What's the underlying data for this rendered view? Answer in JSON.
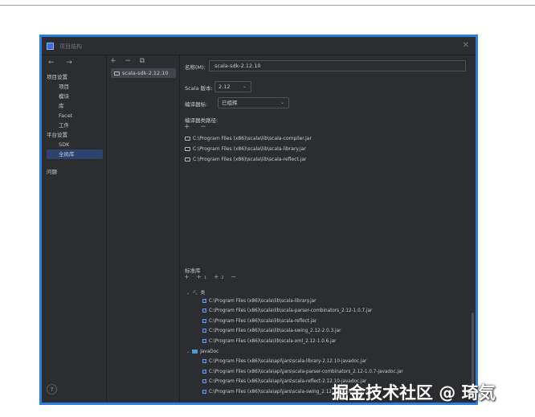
{
  "window": {
    "title": "项目结构",
    "close": "✕"
  },
  "nav": {
    "arrows": "← →",
    "items": [
      {
        "label": "项目设置",
        "type": "head"
      },
      {
        "label": "项目",
        "type": "sub"
      },
      {
        "label": "模块",
        "type": "sub"
      },
      {
        "label": "库",
        "type": "sub"
      },
      {
        "label": "Facet",
        "type": "sub"
      },
      {
        "label": "工件",
        "type": "sub"
      },
      {
        "label": "平台设置",
        "type": "head"
      },
      {
        "label": "SDK",
        "type": "sub"
      },
      {
        "label": "全局库",
        "type": "sub",
        "selected": true
      },
      {
        "label": "问题",
        "type": "head"
      }
    ]
  },
  "middle": {
    "toolbar": "+ − ⧉",
    "sdk": "scala-sdk-2.12.10"
  },
  "form": {
    "name_label": "名称(M):",
    "name_value": "scala-sdk-2.12.10",
    "version_label": "Scala 版本:",
    "version_value": "2.12",
    "compiler_label": "编译器标:",
    "compiler_value": "已组辉",
    "classpath_label": "编译器类路径:",
    "classpath_toolbar": "+ −",
    "classpath": [
      "C:\\Program Files (x86)\\scala\\lib\\scala-compiler.jar",
      "C:\\Program Files (x86)\\scala\\lib\\scala-library.jar",
      "C:\\Program Files (x86)\\scala\\lib\\scala-reflect.jar"
    ]
  },
  "standard": {
    "label": "标准库",
    "toolbar": "+ +₁ +₂ −",
    "classes_label": "类",
    "classes": [
      "C:\\Program Files (x86)\\scala\\lib\\scala-library.jar",
      "C:\\Program Files (x86)\\scala\\lib\\scala-parser-combinators_2.12-1.0.7.jar",
      "C:\\Program Files (x86)\\scala\\lib\\scala-reflect.jar",
      "C:\\Program Files (x86)\\scala\\lib\\scala-swing_2.12-2.0.3.jar",
      "C:\\Program Files (x86)\\scala\\lib\\scala-xml_2.12-1.0.6.jar"
    ],
    "javadoc_label": "JavaDoc",
    "javadoc": [
      "C:\\Program Files (x86)\\scala\\api\\jars\\scala-library-2.12.10-javadoc.jar",
      "C:\\Program Files (x86)\\scala\\api\\jars\\scala-parser-combinators_2.12-1.0.7-javadoc.jar",
      "C:\\Program Files (x86)\\scala\\api\\jars\\scala-reflect-2.12.10-javadoc.jar",
      "C:\\Program Files (x86)\\scala\\api\\jars\\scala-swing_2.12-2.0.3-javadoc.jar"
    ]
  },
  "help": "?",
  "watermark": "掘金技术社区 @ 琦気"
}
